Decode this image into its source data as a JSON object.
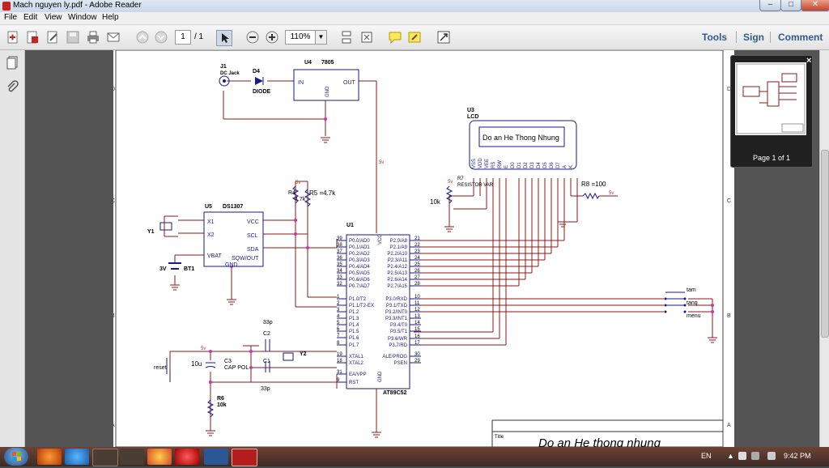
{
  "window": {
    "title": "Mach nguyen ly.pdf - Adobe Reader",
    "controls": {
      "minimize": "–",
      "maximize": "□",
      "close": "✕"
    }
  },
  "menu": {
    "items": [
      "File",
      "Edit",
      "View",
      "Window",
      "Help"
    ]
  },
  "toolbar": {
    "page_current": "1",
    "page_total": "/ 1",
    "zoom": "110%",
    "tools_label": "Tools",
    "sign_label": "Sign",
    "comment_label": "Comment"
  },
  "thumbnail": {
    "caption": "Page 1 of 1",
    "close": "×"
  },
  "schematic": {
    "parts": {
      "j1": {
        "ref": "J1",
        "name": "DC Jack"
      },
      "d4": {
        "ref": "D4",
        "name": "DIODE"
      },
      "u4": {
        "ref": "U4",
        "value": "7805",
        "in": "IN",
        "out": "OUT",
        "gnd": "GND"
      },
      "u3": {
        "ref": "U3",
        "name": "LCD",
        "text": "Do an He Thong Nhung",
        "pins": [
          "VSS",
          "VDD",
          "VEE",
          "RS",
          "RW",
          "E",
          "D0",
          "D1",
          "D2",
          "D3",
          "D4",
          "D5",
          "D6",
          "D7",
          "A",
          "K"
        ]
      },
      "r7": {
        "ref": "R7",
        "name": "RESISTOR VAR",
        "value": "10k"
      },
      "r8": {
        "label": "R8 =100"
      },
      "u5": {
        "ref": "U5",
        "value": "DS1307",
        "pins_left": [
          "X1",
          "X2",
          "VBAT"
        ],
        "pins_right": [
          "VCC",
          "SCL",
          "SDA",
          "SQW/OUT"
        ],
        "gnd": "GND"
      },
      "y1": {
        "ref": "Y1"
      },
      "bt1": {
        "ref": "BT1",
        "value": "3V"
      },
      "r4": {
        "ref": "R4",
        "value": "4.7k"
      },
      "r5": {
        "label": "R5 =4.7k"
      },
      "u1": {
        "ref": "U1",
        "value": "AT89C52",
        "vcc": "VCC",
        "gnd": "GND",
        "left_pins": [
          "P0.0/AD0",
          "P0.1/AD1",
          "P0.2/AD2",
          "P0.3/AD3",
          "P0.4/AD4",
          "P0.5/AD5",
          "P0.6/AD6",
          "P0.7/AD7",
          "P1.0/T2",
          "P1.1/T2-EX",
          "P1.2",
          "P1.3",
          "P1.4",
          "P1.5",
          "P1.6",
          "P1.7",
          "XTAL1",
          "XTAL2",
          "EA/VPP",
          "RST"
        ],
        "left_nums": [
          "39",
          "38",
          "37",
          "36",
          "35",
          "34",
          "33",
          "32",
          "1",
          "2",
          "3",
          "4",
          "5",
          "6",
          "7",
          "8",
          "19",
          "18",
          "31",
          "9"
        ],
        "right_pins": [
          "P2.0/A8",
          "P2.1/A9",
          "P2.2/A10",
          "P2.3/A11",
          "P2.4/A12",
          "P2.5/A13",
          "P2.6/A14",
          "P2.7/A15",
          "P3.0/RXD",
          "P3.1/TXD",
          "P3.2/INT0",
          "P3.3/INT1",
          "P3.4/T0",
          "P3.5/T1",
          "P3.6/WR",
          "P3.7/RD",
          "ALE/PROG",
          "PSEN"
        ],
        "right_nums": [
          "21",
          "22",
          "23",
          "24",
          "25",
          "26",
          "27",
          "28",
          "10",
          "11",
          "12",
          "13",
          "14",
          "15",
          "16",
          "17",
          "30",
          "29"
        ]
      },
      "c2": {
        "ref": "C2",
        "value": "33p"
      },
      "c1": {
        "ref": "C1",
        "value": "33p"
      },
      "y2": {
        "ref": "Y2"
      },
      "c3": {
        "ref": "C3",
        "name": "CAP POL",
        "value": "10u"
      },
      "r6": {
        "ref": "R6",
        "value": "10k"
      },
      "reset": {
        "label": "reset"
      },
      "buttons": [
        "tam",
        "tang",
        "menu"
      ]
    },
    "net_5v": "5v",
    "border_letters": [
      "D",
      "C",
      "B",
      "A"
    ],
    "title_block": {
      "label": "Title",
      "title": "Do an He thong nhung"
    }
  },
  "taskbar": {
    "language": "EN",
    "clock": "9:42 PM"
  },
  "colors": {
    "wire": "#8b1a1a",
    "pin": "#1a1a8b",
    "junction": "#cc33aa",
    "net": "#c0392b",
    "accent_link": "#2f5b8f"
  }
}
